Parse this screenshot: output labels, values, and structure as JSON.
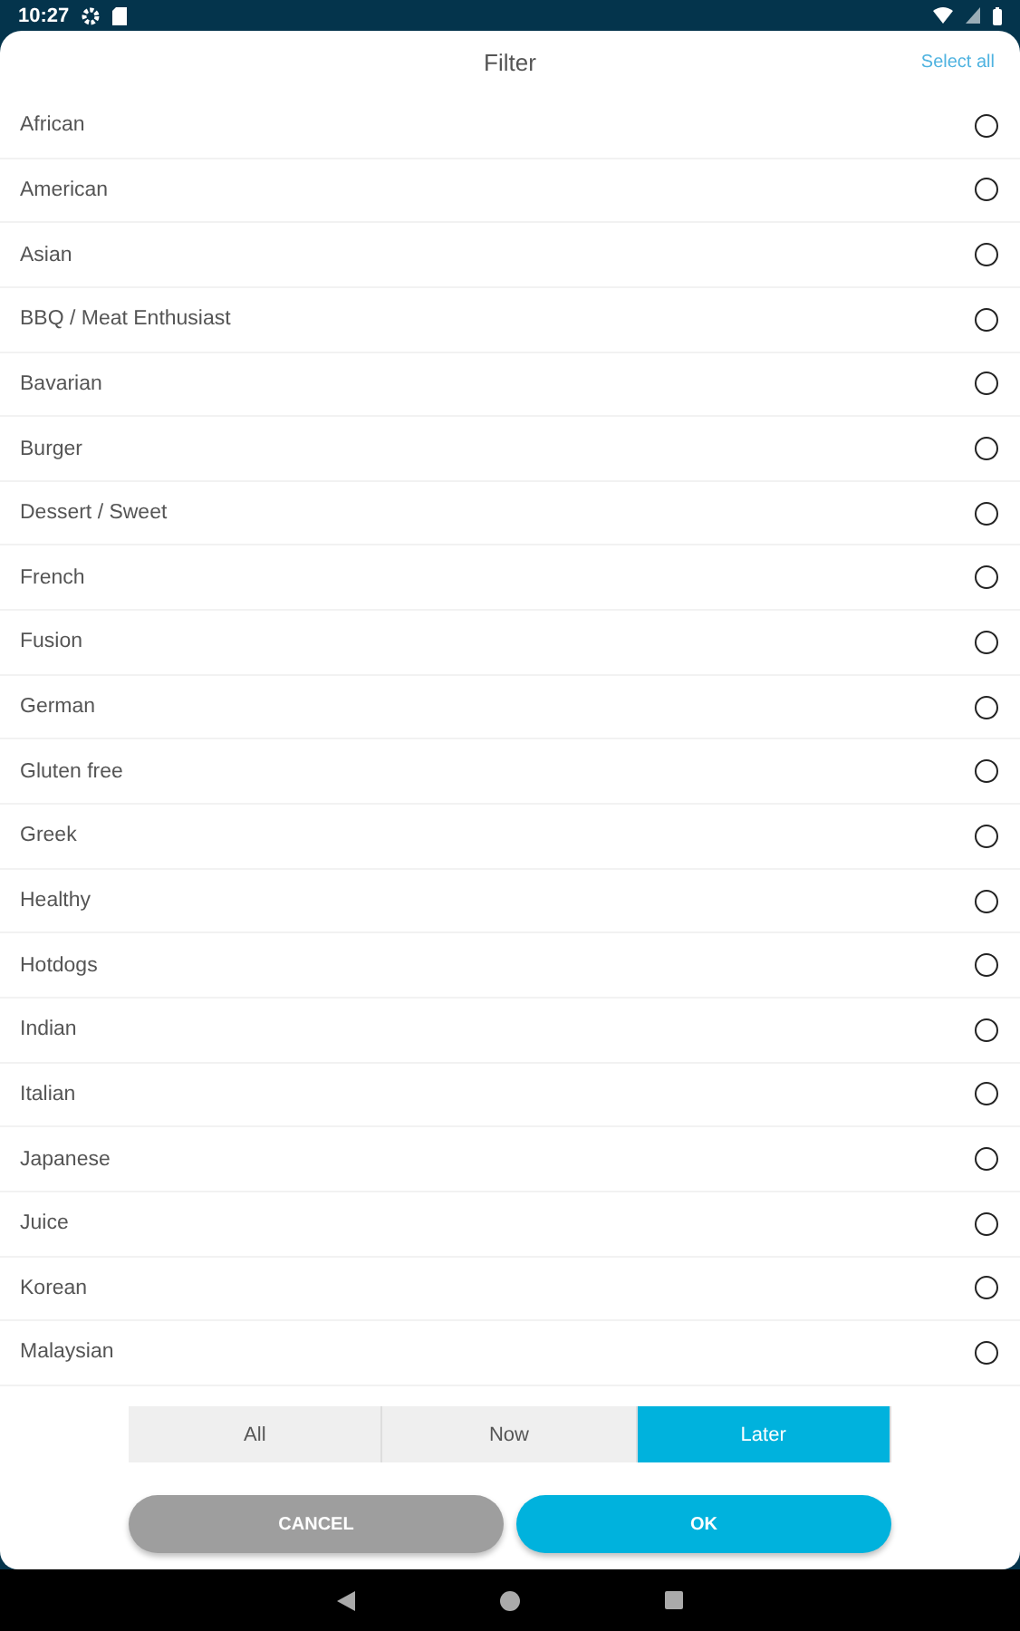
{
  "status_bar": {
    "time": "10:27"
  },
  "header": {
    "title": "Filter",
    "action": "Select all"
  },
  "items": [
    {
      "label": "African",
      "selected": false
    },
    {
      "label": "American",
      "selected": false
    },
    {
      "label": "Asian",
      "selected": false
    },
    {
      "label": "BBQ / Meat Enthusiast",
      "selected": false
    },
    {
      "label": "Bavarian",
      "selected": false
    },
    {
      "label": "Burger",
      "selected": false
    },
    {
      "label": "Dessert / Sweet",
      "selected": false
    },
    {
      "label": "French",
      "selected": false
    },
    {
      "label": "Fusion",
      "selected": false
    },
    {
      "label": "German",
      "selected": false
    },
    {
      "label": "Gluten free",
      "selected": false
    },
    {
      "label": "Greek",
      "selected": false
    },
    {
      "label": "Healthy",
      "selected": false
    },
    {
      "label": "Hotdogs",
      "selected": false
    },
    {
      "label": "Indian",
      "selected": false
    },
    {
      "label": "Italian",
      "selected": false
    },
    {
      "label": "Japanese",
      "selected": false
    },
    {
      "label": "Juice",
      "selected": false
    },
    {
      "label": "Korean",
      "selected": false
    },
    {
      "label": "Malaysian",
      "selected": false
    }
  ],
  "segments": [
    {
      "label": "All",
      "selected": false
    },
    {
      "label": "Now",
      "selected": false
    },
    {
      "label": "Later",
      "selected": true
    }
  ],
  "buttons": [
    {
      "label": "CANCEL",
      "kind": "secondary"
    },
    {
      "label": "OK",
      "kind": "primary"
    }
  ]
}
